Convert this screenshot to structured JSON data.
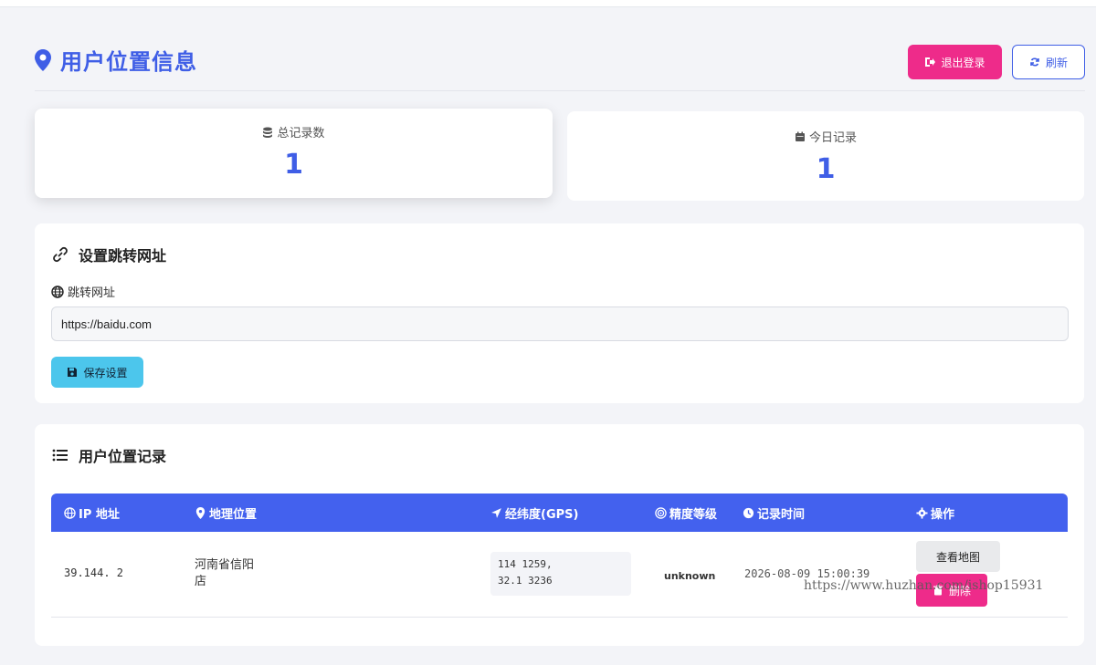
{
  "header": {
    "title": "用户位置信息",
    "logout_label": "退出登录",
    "refresh_label": "刷新"
  },
  "stats": {
    "total_label": "总记录数",
    "total_value": "1",
    "today_label": "今日记录",
    "today_value": "1"
  },
  "settings": {
    "title": "设置跳转网址",
    "field_label": "跳转网址",
    "url_value": "https://baidu.com",
    "save_label": "保存设置"
  },
  "records": {
    "title": "用户位置记录",
    "columns": [
      "IP 地址",
      "地理位置",
      "经纬度(GPS)",
      "精度等级",
      "记录时间",
      "操作"
    ],
    "rows": [
      {
        "ip": "39.144.    2",
        "address_line1": "河南省信阳",
        "address_line2": "店",
        "gps_line1": "114    1259,",
        "gps_line2": "32.1   3236",
        "accuracy": "unknown",
        "time": "2026-08-09 15:00:39",
        "map_label": "查看地图",
        "delete_label": "删除"
      }
    ]
  },
  "watermark": "https://www.huzhan.com/ishop15931",
  "colors": {
    "primary": "#3f5ee6",
    "table_header": "#4361ee",
    "danger": "#ee2b8a",
    "info": "#4cc6ec"
  }
}
